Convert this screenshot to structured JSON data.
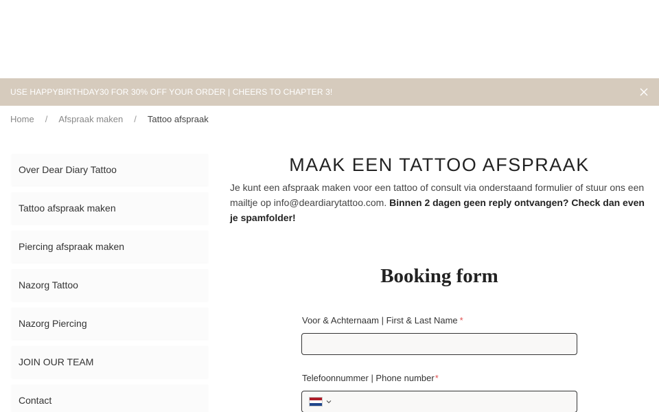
{
  "promo": {
    "text": "USE HAPPYBIRTHDAY30 FOR 30% OFF YOUR ORDER | CHEERS TO CHAPTER 3!"
  },
  "breadcrumb": {
    "items": [
      "Home",
      "Afspraak maken",
      "Tattoo afspraak"
    ],
    "separator": "/"
  },
  "sidebar": {
    "items": [
      {
        "label": "Over Dear Diary Tattoo"
      },
      {
        "label": "Tattoo afspraak maken"
      },
      {
        "label": "Piercing afspraak maken"
      },
      {
        "label": "Nazorg Tattoo"
      },
      {
        "label": "Nazorg Piercing"
      },
      {
        "label": "JOIN OUR TEAM"
      },
      {
        "label": "Contact"
      }
    ]
  },
  "main": {
    "title": "MAAK EEN TATTOO AFSPRAAK",
    "intro_text": "Je kunt een afspraak maken voor een tattoo of consult via onderstaand formulier of stuur ons een mailtje op info@deardiarytattoo.com. ",
    "intro_bold": "Binnen 2 dagen geen reply ontvangen? Check dan even je spamfolder!"
  },
  "form": {
    "title": "Booking form",
    "name_label": "Voor & Achternaam | First & Last Name",
    "name_value": "",
    "phone_label": "Telefoonnummer | Phone number",
    "phone_value": "",
    "required_mark": "*",
    "country_flag": "netherlands-flag-icon"
  },
  "colors": {
    "promo_bg": "#d6cbbd",
    "required": "#e05050",
    "input_bg": "#f9f8f7"
  }
}
